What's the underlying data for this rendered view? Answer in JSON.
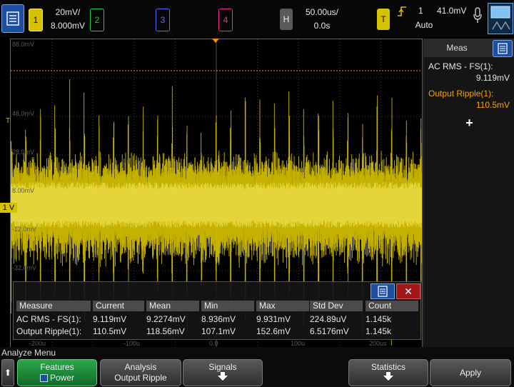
{
  "top_bar": {
    "ch1": {
      "label": "1",
      "scale": "20mV/",
      "offset": "8.000mV",
      "color": "#d6c200"
    },
    "ch2": {
      "label": "2",
      "color": "#21c94a"
    },
    "ch3": {
      "label": "3",
      "color": "#5a6cff"
    },
    "ch4": {
      "label": "4",
      "color": "#f0328b"
    },
    "horizontal": {
      "label": "H",
      "timebase": "50.00us/",
      "delay": "0.0s"
    },
    "trigger": {
      "label": "T",
      "source": "1",
      "level": "41.0mV",
      "mode": "Auto"
    }
  },
  "graticule": {
    "y_ticks": [
      "88.0mV",
      "48.0mV",
      "28.0mV",
      "8.00mV",
      "-12.0mV",
      "-32.0mV"
    ],
    "x_ticks": [
      "-200u",
      "-100u",
      "0.0",
      "100u",
      "200us"
    ],
    "ground_marker": "1",
    "level_marker": "T",
    "trace_color": "#d6c200",
    "trigger_line_color": "#ff8c00"
  },
  "meas_panel": {
    "title": "Meas",
    "items": [
      {
        "name": "AC RMS - FS(1):",
        "value": "9.119mV",
        "color": "#e6e6e6"
      },
      {
        "name": "Output Ripple(1):",
        "value": "110.5mV",
        "color": "#f2a400"
      }
    ],
    "add_label": "+"
  },
  "meas_table": {
    "headers": [
      "Measure",
      "Current",
      "Mean",
      "Min",
      "Max",
      "Std Dev",
      "Count"
    ],
    "rows": [
      [
        "AC RMS - FS(1):",
        "9.119mV",
        "9.2274mV",
        "8.936mV",
        "9.931mV",
        "224.89uV",
        "1.145k"
      ],
      [
        "Output Ripple(1):",
        "110.5mV",
        "118.56mV",
        "107.1mV",
        "152.6mV",
        "6.5176mV",
        "1.145k"
      ]
    ],
    "close_label": "✕"
  },
  "bottom_menu": {
    "title": "Analyze Menu",
    "back_label": "⬆",
    "keys": {
      "features": {
        "line1": "Features",
        "line2": "Power"
      },
      "analysis": {
        "line1": "Analysis",
        "line2": "Output Ripple"
      },
      "signals": {
        "line1": "Signals"
      },
      "statistics": {
        "line1": "Statistics"
      },
      "apply": {
        "line1": "Apply"
      }
    }
  }
}
